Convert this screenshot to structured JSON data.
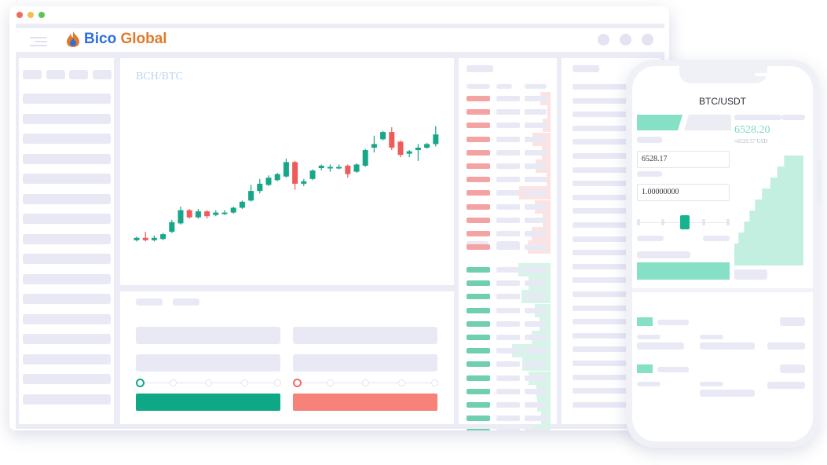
{
  "colors": {
    "green": "#0ea886",
    "red": "#f7827a",
    "candle_up": "#16a688",
    "candle_down": "#ef5b5b",
    "brand_blue": "#2c6fe0",
    "brand_orange": "#e07a2a",
    "placeholder": "#e9e9f6"
  },
  "window": {
    "traffic_lights": [
      "#ef6b5e",
      "#f5be4f",
      "#5ec454"
    ]
  },
  "header": {
    "logo_icon": "flame-drop-icon",
    "brand_part1": "Bico",
    "brand_part2": "Global"
  },
  "chart": {
    "pair": "BCH/BTC"
  },
  "chart_data": {
    "type": "candlestick",
    "title": "BCH/BTC",
    "ylim": [
      0,
      100
    ],
    "candles": [
      {
        "o": 6,
        "c": 8,
        "h": 9,
        "l": 5
      },
      {
        "o": 8,
        "c": 6,
        "h": 13,
        "l": 5
      },
      {
        "o": 6,
        "c": 8,
        "h": 10,
        "l": 5
      },
      {
        "o": 7,
        "c": 11,
        "h": 12,
        "l": 6
      },
      {
        "o": 13,
        "c": 21,
        "h": 23,
        "l": 12
      },
      {
        "o": 20,
        "c": 31,
        "h": 34,
        "l": 19
      },
      {
        "o": 31,
        "c": 25,
        "h": 32,
        "l": 24
      },
      {
        "o": 25,
        "c": 30,
        "h": 32,
        "l": 24
      },
      {
        "o": 30,
        "c": 26,
        "h": 31,
        "l": 24
      },
      {
        "o": 27,
        "c": 29,
        "h": 31,
        "l": 26
      },
      {
        "o": 29,
        "c": 29,
        "h": 31,
        "l": 27
      },
      {
        "o": 29,
        "c": 33,
        "h": 34,
        "l": 28
      },
      {
        "o": 33,
        "c": 38,
        "h": 39,
        "l": 32
      },
      {
        "o": 39,
        "c": 47,
        "h": 52,
        "l": 38
      },
      {
        "o": 47,
        "c": 53,
        "h": 57,
        "l": 45
      },
      {
        "o": 52,
        "c": 58,
        "h": 60,
        "l": 51
      },
      {
        "o": 56,
        "c": 61,
        "h": 62,
        "l": 55
      },
      {
        "o": 59,
        "c": 71,
        "h": 74,
        "l": 58
      },
      {
        "o": 71,
        "c": 53,
        "h": 72,
        "l": 48
      },
      {
        "o": 53,
        "c": 55,
        "h": 57,
        "l": 51
      },
      {
        "o": 57,
        "c": 64,
        "h": 65,
        "l": 56
      },
      {
        "o": 66,
        "c": 68,
        "h": 69,
        "l": 64
      },
      {
        "o": 67,
        "c": 67,
        "h": 69,
        "l": 63
      },
      {
        "o": 67,
        "c": 67,
        "h": 69,
        "l": 65
      },
      {
        "o": 68,
        "c": 61,
        "h": 69,
        "l": 58
      },
      {
        "o": 63,
        "c": 69,
        "h": 70,
        "l": 62
      },
      {
        "o": 68,
        "c": 81,
        "h": 82,
        "l": 67
      },
      {
        "o": 83,
        "c": 86,
        "h": 93,
        "l": 79
      },
      {
        "o": 90,
        "c": 96,
        "h": 97,
        "l": 89
      },
      {
        "o": 96,
        "c": 83,
        "h": 100,
        "l": 81
      },
      {
        "o": 88,
        "c": 77,
        "h": 89,
        "l": 75
      },
      {
        "o": 78,
        "c": 80,
        "h": 81,
        "l": 75
      },
      {
        "o": 81,
        "c": 83,
        "h": 86,
        "l": 72
      },
      {
        "o": 83,
        "c": 86,
        "h": 87,
        "l": 82
      },
      {
        "o": 86,
        "c": 94,
        "h": 101,
        "l": 84
      }
    ]
  },
  "order_book": {
    "asks": [
      0.22,
      0.06,
      0.16,
      0.38,
      0.18,
      0.32,
      0.08,
      0.66,
      0.34,
      0.16,
      0.4,
      0.48
    ],
    "bids": [
      0.68,
      0.46,
      0.62,
      0.34,
      0.24,
      0.4,
      0.82,
      0.6,
      0.46,
      0.3,
      0.28,
      0.2,
      0.36
    ]
  },
  "mobile": {
    "pair": "BTC/USDT",
    "last_price": "6528.20",
    "last_price_usd": "≈6529.57 USD",
    "price_input": "6528.17",
    "amount_input": "1.00000000",
    "slider_position": 0.52,
    "depth_levels": [
      0.28,
      0.38,
      0.48,
      0.6,
      0.7,
      0.78,
      0.86,
      0.94,
      1.0,
      1.0
    ]
  }
}
